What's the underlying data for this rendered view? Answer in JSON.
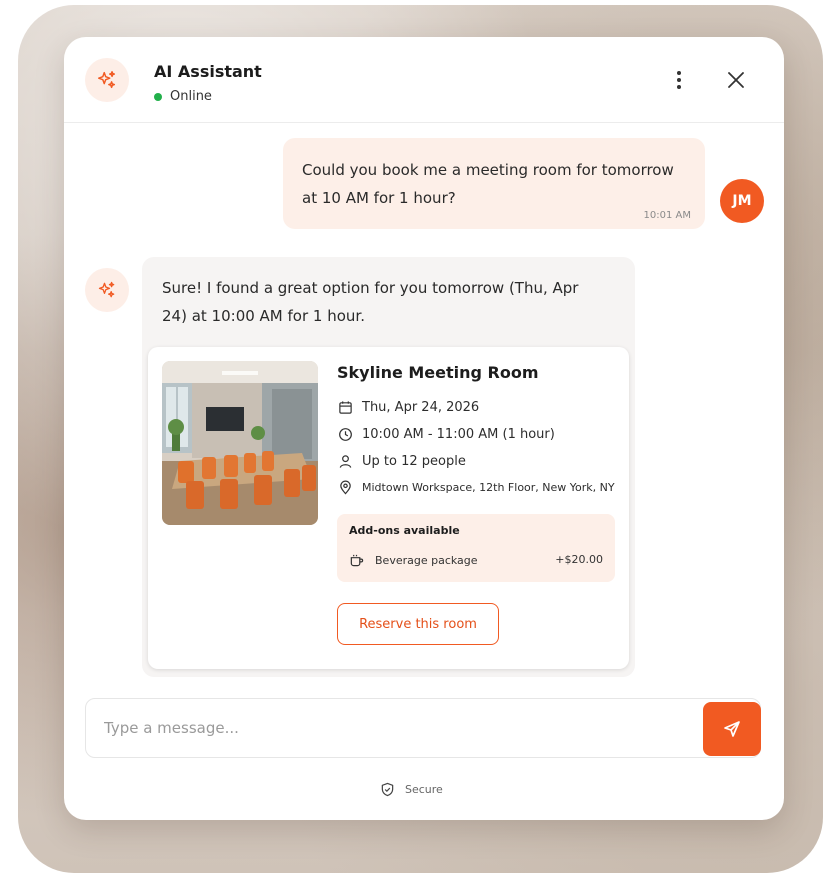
{
  "header": {
    "title": "AI Assistant",
    "status": "Online"
  },
  "messages": {
    "user": {
      "text": "Could you book me a meeting room for tomorrow at 10 AM for 1 hour?",
      "time": "10:01 AM",
      "initials": "JM"
    },
    "bot": {
      "text": "Sure! I found a great option for you tomorrow (Thu, Apr 24) at 10:00 AM for 1 hour."
    }
  },
  "room": {
    "name": "Skyline Meeting Room",
    "date": "Thu, Apr 24, 2026",
    "time": "10:00 AM - 11:00 AM (1 hour)",
    "capacity": "Up to 12 people",
    "location": "Midtown Workspace, 12th Floor, New York, NY",
    "addons_title": "Add-ons available",
    "addon_name": "Beverage package",
    "addon_price": "+$20.00",
    "reserve_label": "Reserve this room"
  },
  "composer": {
    "placeholder": "Type a message..."
  },
  "footer": {
    "secure_label": "Secure"
  },
  "colors": {
    "accent": "#f15a22",
    "online": "#22b04b",
    "bubble_user": "#fdefe8",
    "bubble_bot": "#f6f4f3"
  },
  "icons": [
    "sparkle-icon",
    "more-vertical-icon",
    "close-icon",
    "calendar-icon",
    "clock-icon",
    "person-icon",
    "location-pin-icon",
    "cup-icon",
    "send-icon",
    "shield-icon"
  ]
}
